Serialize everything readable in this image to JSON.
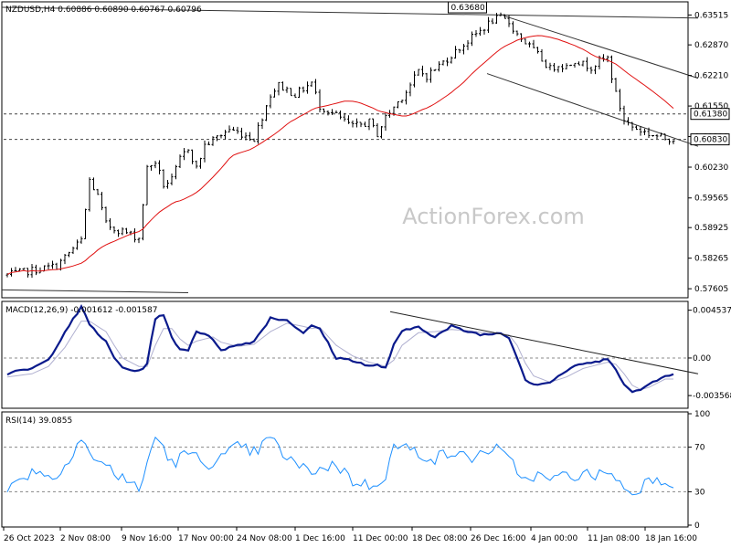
{
  "chart_data": [
    {
      "type": "candlestick",
      "panel": "price",
      "header": "NZDUSD,H4  0.60886 0.60890 0.60767 0.60796",
      "watermark": "ActionForex.com",
      "ylim": [
        0.5745,
        0.6376
      ],
      "y_ticks": [
        "0.63515",
        "0.62870",
        "0.62210",
        "0.61550",
        "0.60890",
        "0.60230",
        "0.59565",
        "0.58925",
        "0.58265",
        "0.57605"
      ],
      "y_tick_values": [
        0.63515,
        0.6287,
        0.6221,
        0.6155,
        0.6089,
        0.6023,
        0.59565,
        0.58925,
        0.58265,
        0.57605
      ],
      "price_labels": [
        {
          "text": "0.61380",
          "value": 0.6138,
          "boxed": true
        },
        {
          "text": "0.60830",
          "value": 0.6083,
          "boxed": true
        }
      ],
      "peak_label": {
        "text": "0.63680",
        "x": 59.5,
        "value": 0.6368
      },
      "ohlc_anchors": [
        [
          0,
          0.579
        ],
        [
          6,
          0.581
        ],
        [
          9,
          0.5865
        ],
        [
          10,
          0.5995
        ],
        [
          11,
          0.596
        ],
        [
          12,
          0.59
        ],
        [
          13,
          0.589
        ],
        [
          14,
          0.5885
        ],
        [
          16,
          0.587
        ],
        [
          17,
          0.602
        ],
        [
          18,
          0.6035
        ],
        [
          19,
          0.5985
        ],
        [
          20,
          0.5995
        ],
        [
          21,
          0.604
        ],
        [
          22,
          0.6065
        ],
        [
          23,
          0.602
        ],
        [
          24,
          0.607
        ],
        [
          27,
          0.6105
        ],
        [
          30,
          0.6085
        ],
        [
          32,
          0.618
        ],
        [
          33,
          0.62
        ],
        [
          35,
          0.618
        ],
        [
          37,
          0.6205
        ],
        [
          38,
          0.6155
        ],
        [
          40,
          0.6135
        ],
        [
          42,
          0.611
        ],
        [
          44,
          0.612
        ],
        [
          45,
          0.6095
        ],
        [
          46,
          0.613
        ],
        [
          48,
          0.6175
        ],
        [
          49,
          0.62
        ],
        [
          50,
          0.623
        ],
        [
          51,
          0.622
        ],
        [
          53,
          0.625
        ],
        [
          55,
          0.628
        ],
        [
          57,
          0.631
        ],
        [
          59,
          0.634
        ],
        [
          60,
          0.6345
        ],
        [
          61,
          0.6335
        ],
        [
          62,
          0.631
        ],
        [
          64,
          0.6275
        ],
        [
          65,
          0.6255
        ],
        [
          66,
          0.6235
        ],
        [
          67,
          0.6245
        ],
        [
          68,
          0.624
        ],
        [
          69,
          0.6255
        ],
        [
          70,
          0.6245
        ],
        [
          71,
          0.624
        ],
        [
          72,
          0.6252
        ],
        [
          73,
          0.6258
        ],
        [
          74,
          0.618
        ],
        [
          75,
          0.6125
        ],
        [
          76,
          0.611
        ],
        [
          78,
          0.6095
        ],
        [
          80,
          0.6085
        ]
      ],
      "moving_average": {
        "color": "#e01010",
        "period": 55
      },
      "channel_lines": [
        {
          "from": [
            0,
            0.6368
          ],
          "to": [
            84,
            0.6345
          ]
        },
        {
          "from": [
            61,
            0.635
          ],
          "to": [
            84,
            0.6215
          ]
        },
        {
          "from": [
            59,
            0.6225
          ],
          "to": [
            84,
            0.6068
          ]
        },
        {
          "from": [
            0,
            0.5758
          ],
          "to": [
            22,
            0.5752
          ]
        }
      ],
      "dashed_levels": [
        0.6138,
        0.6083
      ],
      "n_bars": 81
    },
    {
      "type": "line",
      "panel": "macd",
      "header": "MACD(12,26,9) -0.001612 -0.001587",
      "ylim": [
        -0.0046,
        0.0052
      ],
      "y_ticks": [
        "0.004537",
        "0.00",
        "-0.003568"
      ],
      "y_tick_values": [
        0.004537,
        0.0,
        -0.003568
      ],
      "macd_anchors": [
        [
          0,
          -0.0015
        ],
        [
          3,
          -0.001
        ],
        [
          5,
          -0.0002
        ],
        [
          7,
          0.0025
        ],
        [
          9,
          0.0048
        ],
        [
          10,
          0.0032
        ],
        [
          12,
          0.0015
        ],
        [
          13,
          0.0
        ],
        [
          14,
          -0.0009
        ],
        [
          16,
          -0.0013
        ],
        [
          17,
          -0.0005
        ],
        [
          18,
          0.0038
        ],
        [
          19,
          0.004
        ],
        [
          20,
          0.002
        ],
        [
          21,
          0.0008
        ],
        [
          22,
          0.0008
        ],
        [
          23,
          0.0026
        ],
        [
          25,
          0.0018
        ],
        [
          26,
          0.0008
        ],
        [
          28,
          0.0012
        ],
        [
          30,
          0.0016
        ],
        [
          32,
          0.0038
        ],
        [
          34,
          0.0036
        ],
        [
          36,
          0.0024
        ],
        [
          37,
          0.003
        ],
        [
          38,
          0.0028
        ],
        [
          40,
          0.0
        ],
        [
          42,
          -0.0002
        ],
        [
          44,
          -0.0008
        ],
        [
          45,
          -0.0007
        ],
        [
          46,
          -0.0009
        ],
        [
          47,
          0.0012
        ],
        [
          48,
          0.0025
        ],
        [
          50,
          0.003
        ],
        [
          52,
          0.002
        ],
        [
          54,
          0.003
        ],
        [
          56,
          0.0025
        ],
        [
          58,
          0.0022
        ],
        [
          60,
          0.0024
        ],
        [
          61,
          0.002
        ],
        [
          62,
          0.0
        ],
        [
          63,
          -0.002
        ],
        [
          64,
          -0.0025
        ],
        [
          66,
          -0.0023
        ],
        [
          68,
          -0.0012
        ],
        [
          70,
          -0.0005
        ],
        [
          72,
          -0.0004
        ],
        [
          73,
          0.0
        ],
        [
          74,
          -0.001
        ],
        [
          75,
          -0.0025
        ],
        [
          76,
          -0.0033
        ],
        [
          77,
          -0.003
        ],
        [
          78,
          -0.0025
        ],
        [
          80,
          -0.0016
        ]
      ],
      "signal_anchors": [
        [
          0,
          -0.0018
        ],
        [
          3,
          -0.0015
        ],
        [
          5,
          -0.0008
        ],
        [
          7,
          0.001
        ],
        [
          9,
          0.0035
        ],
        [
          10,
          0.0035
        ],
        [
          12,
          0.0025
        ],
        [
          13,
          0.0012
        ],
        [
          14,
          0.0
        ],
        [
          16,
          -0.0008
        ],
        [
          17,
          -0.0008
        ],
        [
          18,
          0.0012
        ],
        [
          19,
          0.0028
        ],
        [
          20,
          0.0028
        ],
        [
          21,
          0.0018
        ],
        [
          22,
          0.0012
        ],
        [
          23,
          0.0016
        ],
        [
          25,
          0.002
        ],
        [
          26,
          0.0015
        ],
        [
          28,
          0.0011
        ],
        [
          30,
          0.0013
        ],
        [
          32,
          0.0025
        ],
        [
          34,
          0.0033
        ],
        [
          36,
          0.003
        ],
        [
          37,
          0.0028
        ],
        [
          38,
          0.0029
        ],
        [
          40,
          0.0012
        ],
        [
          42,
          0.0002
        ],
        [
          44,
          -0.0004
        ],
        [
          45,
          -0.0006
        ],
        [
          46,
          -0.0008
        ],
        [
          47,
          -0.0002
        ],
        [
          48,
          0.0012
        ],
        [
          50,
          0.0024
        ],
        [
          52,
          0.0025
        ],
        [
          54,
          0.0027
        ],
        [
          56,
          0.0026
        ],
        [
          58,
          0.0024
        ],
        [
          60,
          0.0023
        ],
        [
          61,
          0.0022
        ],
        [
          62,
          0.0012
        ],
        [
          63,
          -0.0005
        ],
        [
          64,
          -0.0017
        ],
        [
          66,
          -0.0023
        ],
        [
          68,
          -0.0018
        ],
        [
          70,
          -0.001
        ],
        [
          72,
          -0.0006
        ],
        [
          73,
          -0.0004
        ],
        [
          74,
          -0.0006
        ],
        [
          75,
          -0.0015
        ],
        [
          76,
          -0.0026
        ],
        [
          77,
          -0.003
        ],
        [
          78,
          -0.0028
        ],
        [
          80,
          -0.002
        ]
      ],
      "trendline": {
        "from": [
          46,
          0.0044
        ],
        "to": [
          84,
          -0.0015
        ]
      },
      "zero_line": 0.0,
      "macd_color": "#0a1a8c",
      "signal_color": "#b0b0d0"
    },
    {
      "type": "line",
      "panel": "rsi",
      "header": "RSI(14) 39.0855",
      "ylim": [
        0,
        100
      ],
      "y_ticks": [
        "100",
        "70",
        "30",
        "0"
      ],
      "y_tick_values": [
        100,
        70,
        30,
        0
      ],
      "levels": [
        70,
        30
      ],
      "rsi_anchors": [
        [
          0,
          30
        ],
        [
          2,
          45
        ],
        [
          4,
          50
        ],
        [
          6,
          40
        ],
        [
          7,
          55
        ],
        [
          9,
          80
        ],
        [
          10,
          65
        ],
        [
          11,
          55
        ],
        [
          12,
          55
        ],
        [
          13,
          45
        ],
        [
          14,
          45
        ],
        [
          16,
          30
        ],
        [
          17,
          55
        ],
        [
          18,
          80
        ],
        [
          19,
          70
        ],
        [
          20,
          55
        ],
        [
          21,
          60
        ],
        [
          22,
          65
        ],
        [
          23,
          60
        ],
        [
          24,
          55
        ],
        [
          26,
          60
        ],
        [
          28,
          70
        ],
        [
          30,
          65
        ],
        [
          32,
          78
        ],
        [
          34,
          60
        ],
        [
          36,
          50
        ],
        [
          38,
          50
        ],
        [
          40,
          55
        ],
        [
          42,
          40
        ],
        [
          44,
          35
        ],
        [
          45,
          40
        ],
        [
          46,
          45
        ],
        [
          47,
          70
        ],
        [
          48,
          70
        ],
        [
          50,
          65
        ],
        [
          52,
          60
        ],
        [
          54,
          65
        ],
        [
          56,
          60
        ],
        [
          58,
          65
        ],
        [
          59,
          70
        ],
        [
          60,
          65
        ],
        [
          62,
          50
        ],
        [
          63,
          40
        ],
        [
          64,
          45
        ],
        [
          66,
          40
        ],
        [
          68,
          45
        ],
        [
          70,
          45
        ],
        [
          72,
          45
        ],
        [
          73,
          50
        ],
        [
          74,
          40
        ],
        [
          75,
          35
        ],
        [
          76,
          28
        ],
        [
          77,
          35
        ],
        [
          78,
          40
        ],
        [
          79,
          45
        ],
        [
          80,
          39
        ]
      ],
      "rsi_color": "#1e90ff"
    }
  ],
  "x_axis": {
    "labels": [
      "26 Oct 2023",
      "2 Nov 08:00",
      "9 Nov 16:00",
      "17 Nov 00:00",
      "24 Nov 08:00",
      "1 Dec 16:00",
      "11 Dec 00:00",
      "18 Dec 08:00",
      "26 Dec 16:00",
      "4 Jan 00:00",
      "11 Jan 08:00",
      "18 Jan 16:00"
    ],
    "label_bars": [
      0,
      9,
      18,
      27,
      36,
      45,
      54,
      63,
      72,
      81,
      90,
      99
    ],
    "bars_per_label": 9
  }
}
